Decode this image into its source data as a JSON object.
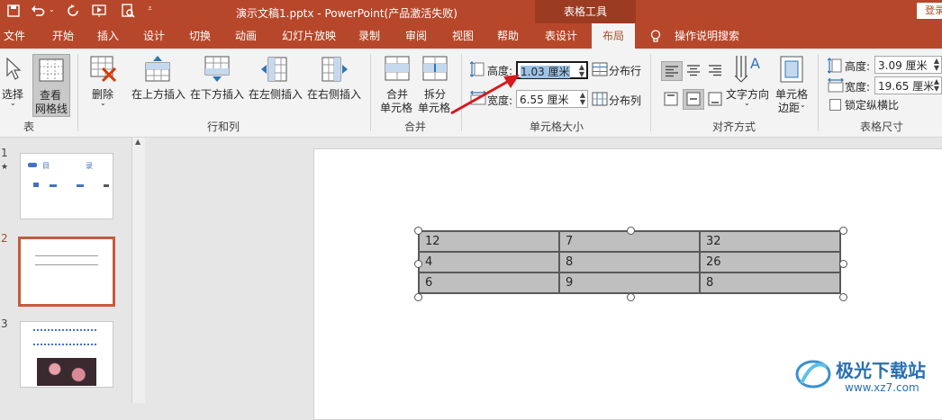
{
  "titlebar": {
    "save_icon": "save-icon",
    "file_title": "演示文稿1.pptx  -  PowerPoint(产品激活失败)",
    "tool_group": "表格工具",
    "login": "登录"
  },
  "tabs": [
    "文件",
    "开始",
    "插入",
    "设计",
    "切换",
    "动画",
    "幻灯片放映",
    "录制",
    "审阅",
    "视图",
    "帮助",
    "表设计",
    "布局"
  ],
  "active_tab": "布局",
  "search_hint": "操作说明搜索",
  "ribbon": {
    "select_label": "选择",
    "view_grid_label": "查看\n网格线",
    "view_grid_l1": "查看",
    "view_grid_l2": "网格线",
    "group_table": "表",
    "delete_label": "删除",
    "insert_above": "在上方插入",
    "insert_below": "在下方插入",
    "insert_left": "在左侧插入",
    "insert_right": "在右侧插入",
    "group_rows_cols": "行和列",
    "merge_l1": "合并",
    "merge_l2": "单元格",
    "split_l1": "拆分",
    "split_l2": "单元格",
    "group_merge": "合并",
    "height_label": "高度:",
    "height_value": "1.03 厘米",
    "width_label": "宽度:",
    "width_value": "6.55 厘米",
    "dist_rows": "分布行",
    "dist_cols": "分布列",
    "group_cell_size": "单元格大小",
    "text_dir": "文字方向",
    "cell_margin_l1": "单元格",
    "cell_margin_l2": "边距",
    "group_align": "对齐方式",
    "tbl_height_label": "高度:",
    "tbl_height_value": "3.09 厘米",
    "tbl_width_label": "宽度:",
    "tbl_width_value": "19.65 厘米",
    "lock_ratio": "锁定纵横比",
    "group_table_size": "表格尺寸"
  },
  "slides": [
    {
      "num": "1",
      "star": "★",
      "text_a": "目",
      "text_b": "录"
    },
    {
      "num": "2"
    },
    {
      "num": "3"
    }
  ],
  "table": {
    "rows": [
      [
        "12",
        "7",
        "32"
      ],
      [
        "4",
        "8",
        "26"
      ],
      [
        "6",
        "9",
        "8"
      ]
    ]
  },
  "watermark": {
    "name": "极光下载站",
    "url": "www.xz7.com"
  },
  "colors": {
    "accent": "#b7472a",
    "arrow": "#d71920"
  }
}
